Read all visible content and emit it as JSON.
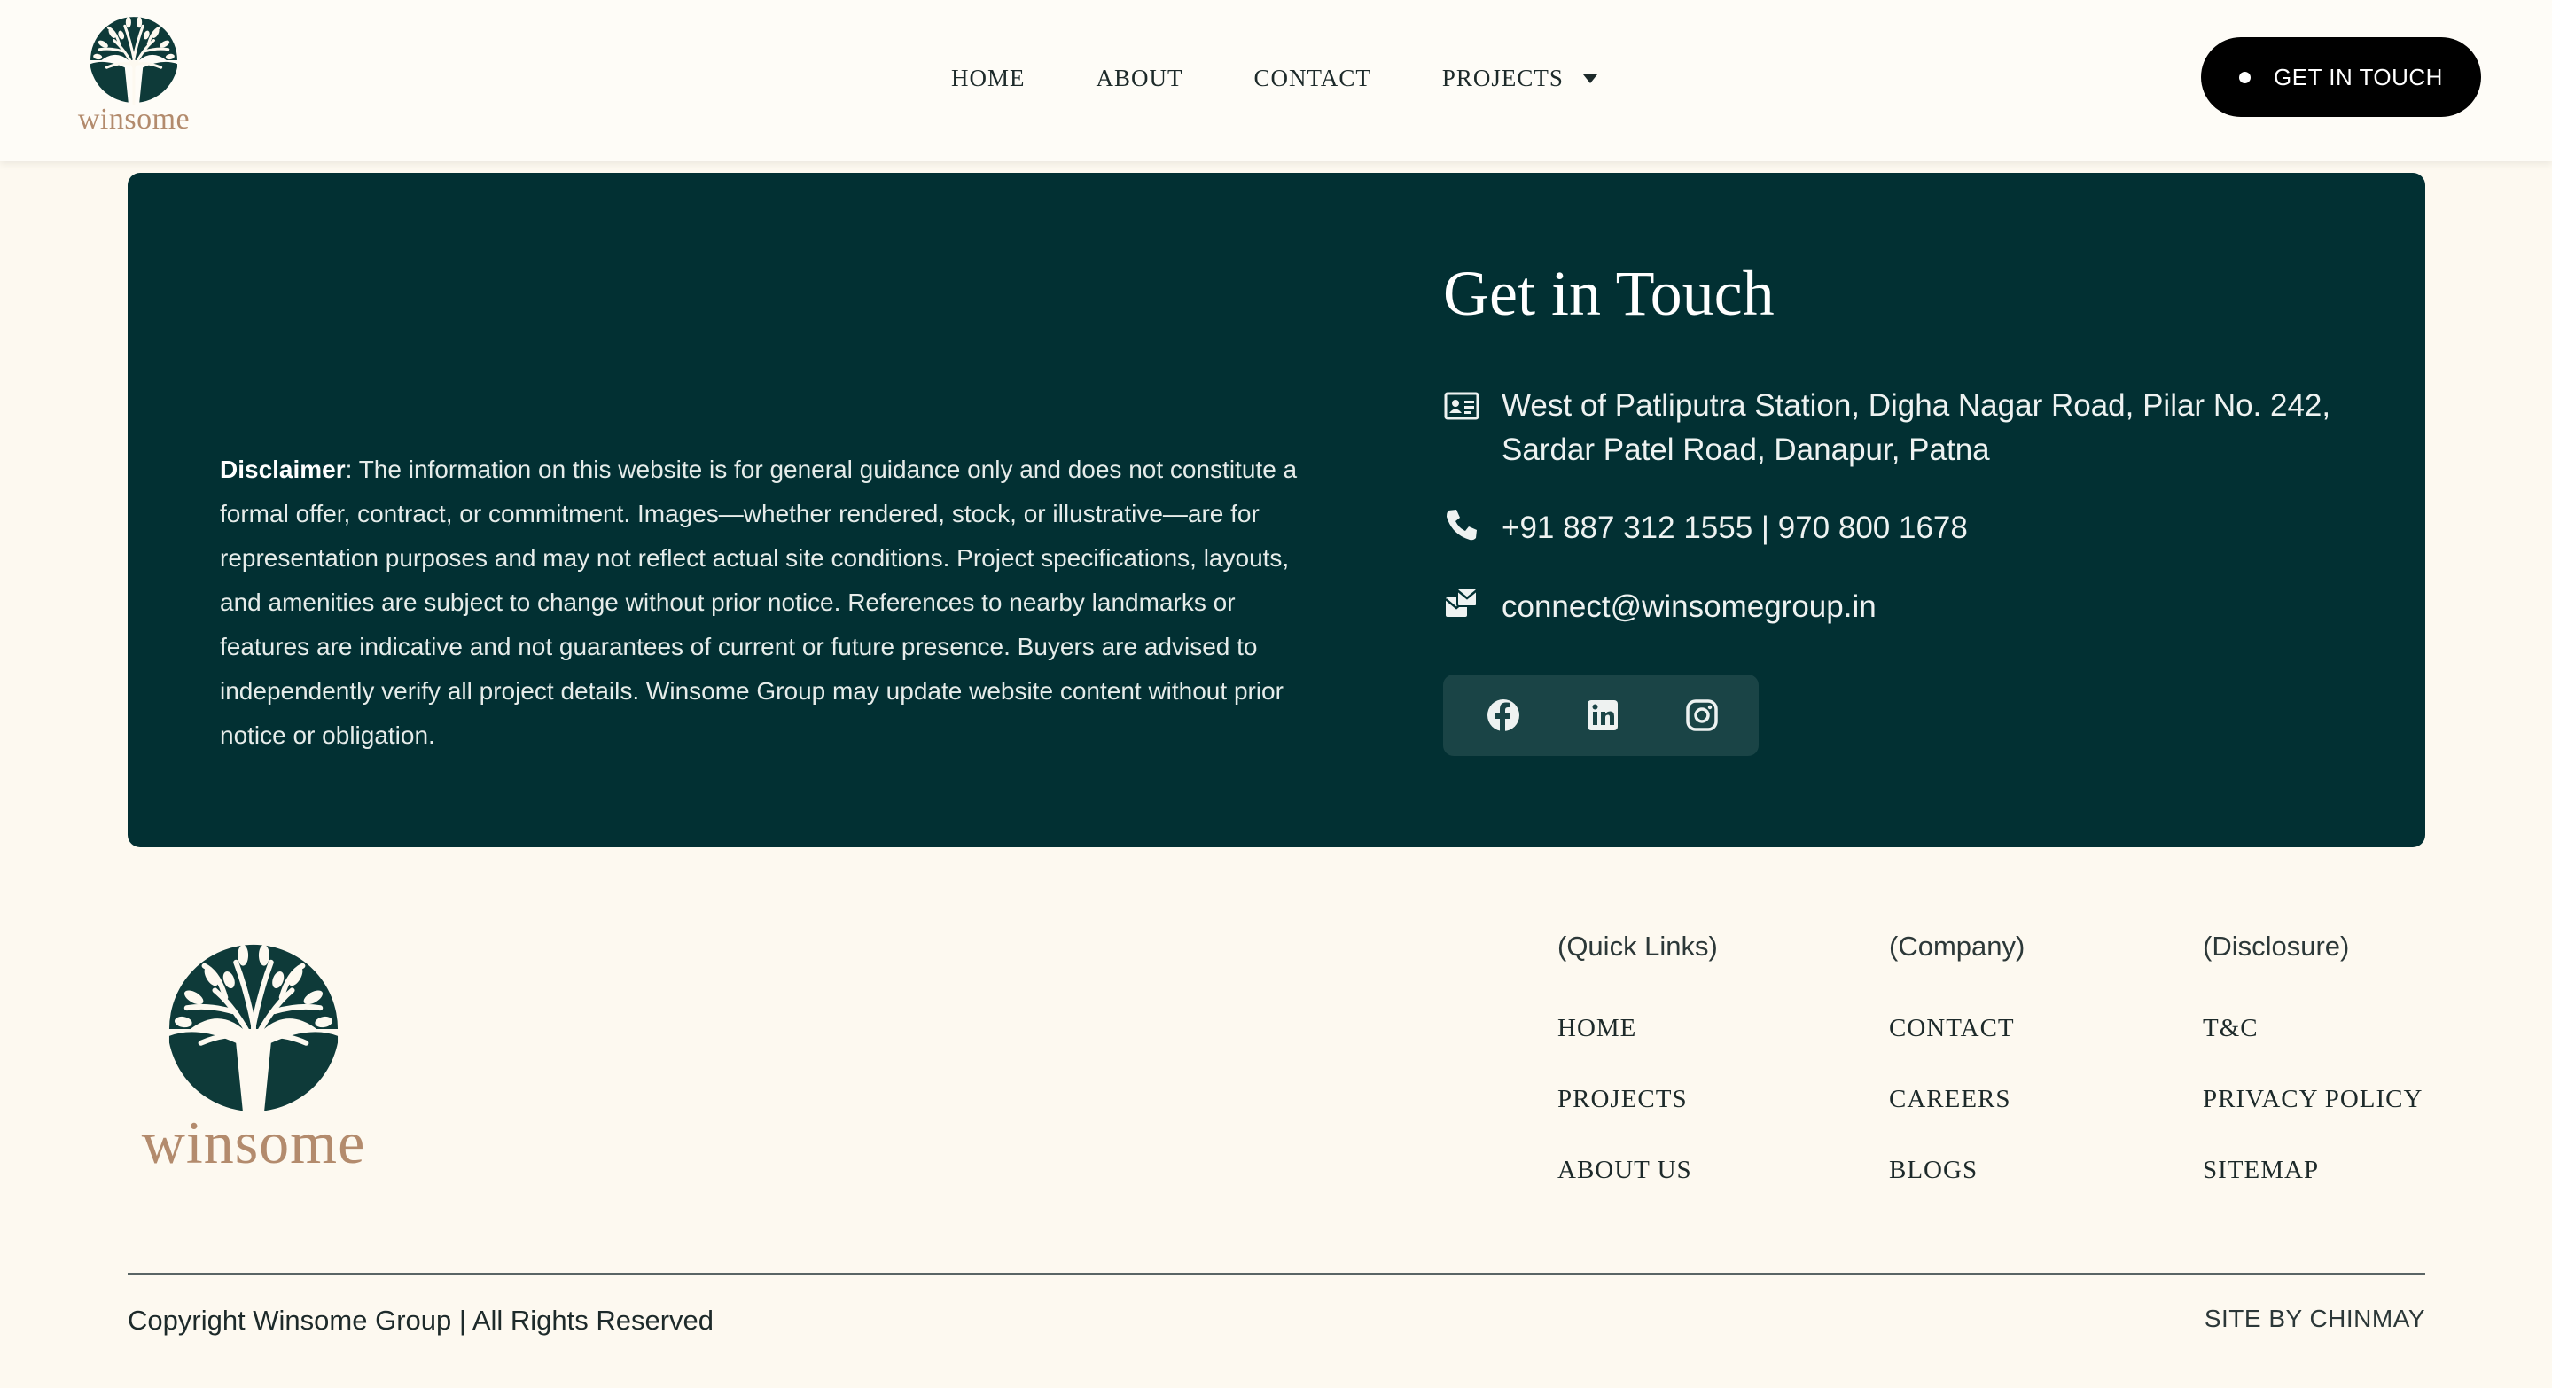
{
  "brand": {
    "name": "winsome",
    "tree_color": "#0e3a39",
    "wordmark_color": "#b38b6d"
  },
  "nav": {
    "items": [
      {
        "label": "HOME"
      },
      {
        "label": "ABOUT"
      },
      {
        "label": "CONTACT"
      },
      {
        "label": "PROJECTS"
      }
    ],
    "cta_label": "GET IN TOUCH"
  },
  "panel": {
    "background": "#023033",
    "disclaimer_heading": "Disclaimer",
    "disclaimer_text": ": The information on this website is for general guidance only and does not constitute a formal offer, contract, or commitment. Images—whether rendered, stock, or illustrative—are for representation purposes and may not reflect actual site conditions. Project specifications, layouts, and amenities are subject to change without prior notice. References to nearby landmarks or features are indicative and not guarantees of current or future presence. Buyers are advised to independently verify all project details. Winsome Group may update website content without prior notice or obligation.",
    "title": "Get in Touch",
    "address_line1": "West of Patliputra Station, Digha Nagar Road, Pilar No. 242,",
    "address_line2": "Sardar Patel Road, Danapur, Patna",
    "phone": "+91 887 312 1555 | 970 800 1678",
    "email": "connect@winsomegroup.in",
    "social": [
      "facebook-icon",
      "linkedin-icon",
      "instagram-icon"
    ]
  },
  "footer": {
    "columns": [
      {
        "heading": "(Quick Links)",
        "links": [
          "HOME",
          "PROJECTS",
          "ABOUT US"
        ]
      },
      {
        "heading": "(Company)",
        "links": [
          "CONTACT",
          "CAREERS",
          "BLOGS"
        ]
      },
      {
        "heading": "(Disclosure)",
        "links": [
          "T&C",
          "PRIVACY POLICY",
          "SITEMAP"
        ]
      }
    ],
    "copyright": "Copyright Winsome Group | All Rights Reserved",
    "site_by": "SITE BY CHINMAY"
  }
}
